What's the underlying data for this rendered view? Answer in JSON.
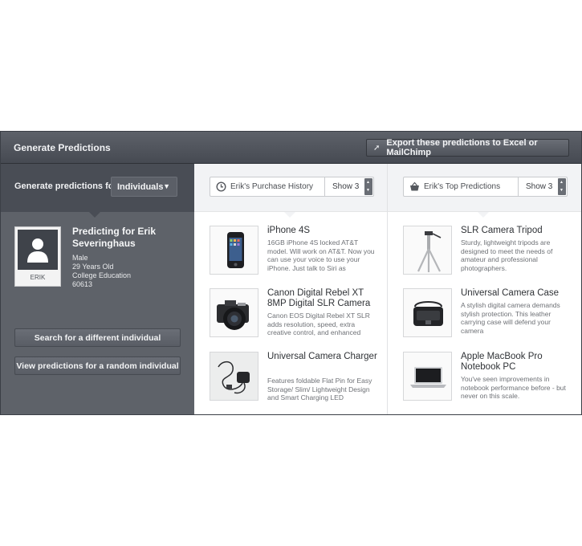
{
  "header": {
    "title": "Generate Predictions",
    "export_label": "Export these predictions to Excel or MailChimp"
  },
  "left": {
    "generate_label": "Generate predictions for",
    "dropdown_value": "Individuals",
    "avatar_name": "ERIK",
    "predicting_title": "Predicting for Erik Severinghaus",
    "details": [
      "Male",
      "29 Years Old",
      "College Education",
      "60613"
    ],
    "search_button": "Search for a different individual",
    "random_button": "View predictions for a random individual"
  },
  "history": {
    "label": "Erik's Purchase History",
    "show": "Show 3",
    "items": [
      {
        "title": "iPhone 4S",
        "desc": "16GB iPhone 4S locked AT&T model. Will work on AT&T. Now you can use your voice to use your iPhone. Just talk to Siri as"
      },
      {
        "title": "Canon Digital Rebel XT 8MP Digital SLR Camera",
        "desc": "Canon EOS Digital Rebel XT SLR adds resolution, speed, extra creative control, and enhanced"
      },
      {
        "title": "Universal Camera Charger",
        "desc": "Features foldable Flat Pin for Easy Storage/ Slim/ Lightweight Design and Smart Charging LED"
      }
    ]
  },
  "predictions": {
    "label": "Erik's Top Predictions",
    "show": "Show 3",
    "items": [
      {
        "title": "SLR Camera Tripod",
        "desc": "Sturdy, lightweight tripods are designed to meet the needs of amateur and professional photographers."
      },
      {
        "title": "Universal Camera Case",
        "desc": "A stylish digital camera demands stylish protection. This leather carrying case will defend your camera"
      },
      {
        "title": "Apple MacBook Pro Notebook PC",
        "desc": "You've seen improvements in notebook performance before - but never on this scale."
      }
    ]
  },
  "icons": {
    "export": "arrow-up-right-icon",
    "dropdown": "caret-down-icon",
    "history": "clock-icon",
    "predictions": "basket-icon",
    "avatar": "user-silhouette-icon"
  },
  "colors": {
    "header_bg": "#4f535b",
    "left_panel": "#5e6269",
    "left_top": "#494d55",
    "column_top": "#f2f3f5"
  }
}
